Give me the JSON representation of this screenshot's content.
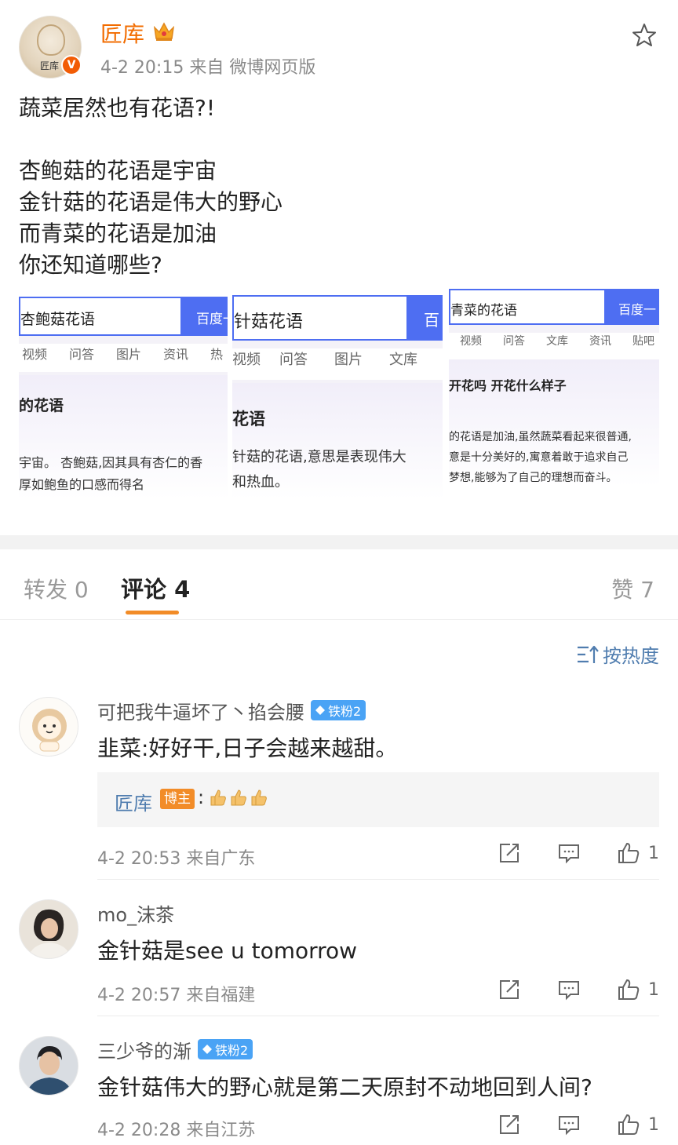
{
  "post": {
    "author": "匠库",
    "avatar_text": "匠库",
    "verified_mark": "V",
    "meta": "4-2 20:15  来自 微博网页版",
    "lines": [
      "蔬菜居然也有花语?!",
      "",
      "杏鲍菇的花语是宇宙",
      "金针菇的花语是伟大的野心",
      "而青菜的花语是加油",
      "你还知道哪些?"
    ]
  },
  "images": [
    {
      "search_text": "杏鲍菇花语",
      "button": "百度一",
      "tabs": [
        "视频",
        "问答",
        "图片",
        "资讯",
        "热"
      ],
      "card_title": "的花语",
      "card_lines": [
        "宇宙。 杏鲍菇,因其具有杏仁的香",
        "厚如鲍鱼的口感而得名"
      ]
    },
    {
      "search_text": "针菇花语",
      "button": "百",
      "tabs": [
        "视频",
        "问答",
        "图片",
        "文库"
      ],
      "card_title": "花语",
      "card_lines": [
        "针菇的花语,意思是表现伟大",
        "和热血。"
      ]
    },
    {
      "search_text": "青菜的花语",
      "button": "百度一",
      "tabs": [
        "视频",
        "问答",
        "文库",
        "资讯",
        "贴吧"
      ],
      "card_title": "开花吗 开花什么样子",
      "card_lines": [
        "的花语是加油,虽然蔬菜看起来很普通,",
        "意是十分美好的,寓意着敢于追求自己",
        "梦想,能够为了自己的理想而奋斗。"
      ]
    }
  ],
  "tabs": {
    "repost": "转发 0",
    "comments": "评论 4",
    "likes": "赞 7"
  },
  "sort_label": "按热度",
  "comments": [
    {
      "name": "可把我牛逼坏了丶掐会腰",
      "badge": "铁粉2",
      "text": "韭菜:好好干,日子会越来越甜。",
      "meta": "4-2 20:53  来自广东",
      "likes": "1",
      "reply": {
        "name": "匠库",
        "badge": "博主",
        "colon": ":"
      }
    },
    {
      "name": "mo_沫茶",
      "badge": "",
      "text": "金针菇是see u tomorrow",
      "meta": "4-2 20:57  来自福建",
      "likes": "1"
    },
    {
      "name": "三少爷的渐",
      "badge": "铁粉2",
      "text": "金针菇伟大的野心就是第二天原封不动地回到人间?",
      "meta": "4-2 20:28  来自江苏",
      "likes": "1"
    }
  ],
  "colors": {
    "author_orange": "#f26c00",
    "link_blue": "#507daf",
    "tab_accent": "#f28c28",
    "badge_blue": "#4aa3f5",
    "baidu_blue": "#4e6ef2"
  },
  "icons": [
    "crown-icon",
    "star-icon",
    "sort-icon",
    "share-icon",
    "comment-icon",
    "like-icon",
    "gem-icon",
    "thumbs-up-emoji"
  ]
}
